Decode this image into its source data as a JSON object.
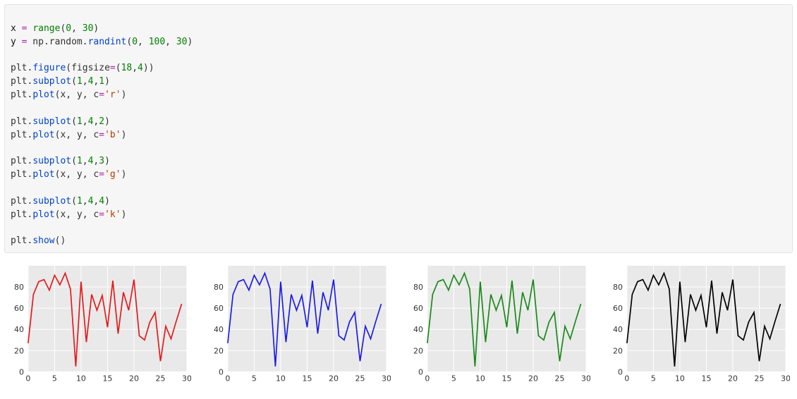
{
  "code": {
    "line1_a": "x ",
    "line1_op1": "=",
    "line1_b": " ",
    "line1_fn": "range",
    "line1_c": "(",
    "line1_n1": "0",
    "line1_d": ", ",
    "line1_n2": "30",
    "line1_e": ")",
    "line2_a": "y ",
    "line2_op1": "=",
    "line2_b": " np.random.",
    "line2_fn": "randint",
    "line2_c": "(",
    "line2_n1": "0",
    "line2_d": ", ",
    "line2_n2": "100",
    "line2_e": ", ",
    "line2_n3": "30",
    "line2_f": ")",
    "line3_a": "plt.",
    "line3_fn": "figure",
    "line3_b": "(figsize",
    "line3_op": "=",
    "line3_c": "(",
    "line3_n1": "18",
    "line3_d": ",",
    "line3_n2": "4",
    "line3_e": "))",
    "line4_a": "plt.",
    "line4_fn": "subplot",
    "line4_b": "(",
    "line4_n1": "1",
    "line4_c": ",",
    "line4_n2": "4",
    "line4_d": ",",
    "line4_n3": "1",
    "line4_e": ")",
    "line5_a": "plt.",
    "line5_fn": "plot",
    "line5_b": "(x, y, c",
    "line5_op": "=",
    "line5_s": "'r'",
    "line5_c": ")",
    "line6_a": "plt.",
    "line6_fn": "subplot",
    "line6_b": "(",
    "line6_n1": "1",
    "line6_c": ",",
    "line6_n2": "4",
    "line6_d": ",",
    "line6_n3": "2",
    "line6_e": ")",
    "line7_a": "plt.",
    "line7_fn": "plot",
    "line7_b": "(x, y, c",
    "line7_op": "=",
    "line7_s": "'b'",
    "line7_c": ")",
    "line8_a": "plt.",
    "line8_fn": "subplot",
    "line8_b": "(",
    "line8_n1": "1",
    "line8_c": ",",
    "line8_n2": "4",
    "line8_d": ",",
    "line8_n3": "3",
    "line8_e": ")",
    "line9_a": "plt.",
    "line9_fn": "plot",
    "line9_b": "(x, y, c",
    "line9_op": "=",
    "line9_s": "'g'",
    "line9_c": ")",
    "line10_a": "plt.",
    "line10_fn": "subplot",
    "line10_b": "(",
    "line10_n1": "1",
    "line10_c": ",",
    "line10_n2": "4",
    "line10_d": ",",
    "line10_n3": "4",
    "line10_e": ")",
    "line11_a": "plt.",
    "line11_fn": "plot",
    "line11_b": "(x, y, c",
    "line11_op": "=",
    "line11_s": "'k'",
    "line11_c": ")",
    "line12_a": "plt.",
    "line12_fn": "show",
    "line12_b": "()"
  },
  "chart_data": [
    {
      "type": "line",
      "x": [
        0,
        1,
        2,
        3,
        4,
        5,
        6,
        7,
        8,
        9,
        10,
        11,
        12,
        13,
        14,
        15,
        16,
        17,
        18,
        19,
        20,
        21,
        22,
        23,
        24,
        25,
        26,
        27,
        28,
        29
      ],
      "values": [
        27,
        73,
        85,
        87,
        77,
        91,
        82,
        93,
        78,
        5,
        85,
        28,
        73,
        58,
        72,
        42,
        86,
        36,
        75,
        58,
        87,
        34,
        30,
        47,
        56,
        10,
        43,
        31,
        48,
        64
      ],
      "color": "#e41a1c",
      "xlim": [
        0,
        30
      ],
      "ylim": [
        0,
        100
      ],
      "xticks": [
        0,
        5,
        10,
        15,
        20,
        25,
        30
      ],
      "yticks": [
        0,
        20,
        40,
        60,
        80
      ]
    },
    {
      "type": "line",
      "x": [
        0,
        1,
        2,
        3,
        4,
        5,
        6,
        7,
        8,
        9,
        10,
        11,
        12,
        13,
        14,
        15,
        16,
        17,
        18,
        19,
        20,
        21,
        22,
        23,
        24,
        25,
        26,
        27,
        28,
        29
      ],
      "values": [
        27,
        73,
        85,
        87,
        77,
        91,
        82,
        93,
        78,
        5,
        85,
        28,
        73,
        58,
        72,
        42,
        86,
        36,
        75,
        58,
        87,
        34,
        30,
        47,
        56,
        10,
        43,
        31,
        48,
        64
      ],
      "color": "#1c1ce8",
      "xlim": [
        0,
        30
      ],
      "ylim": [
        0,
        100
      ],
      "xticks": [
        0,
        5,
        10,
        15,
        20,
        25,
        30
      ],
      "yticks": [
        0,
        20,
        40,
        60,
        80
      ]
    },
    {
      "type": "line",
      "x": [
        0,
        1,
        2,
        3,
        4,
        5,
        6,
        7,
        8,
        9,
        10,
        11,
        12,
        13,
        14,
        15,
        16,
        17,
        18,
        19,
        20,
        21,
        22,
        23,
        24,
        25,
        26,
        27,
        28,
        29
      ],
      "values": [
        27,
        73,
        85,
        87,
        77,
        91,
        82,
        93,
        78,
        5,
        85,
        28,
        73,
        58,
        72,
        42,
        86,
        36,
        75,
        58,
        87,
        34,
        30,
        47,
        56,
        10,
        43,
        31,
        48,
        64
      ],
      "color": "#188a18",
      "xlim": [
        0,
        30
      ],
      "ylim": [
        0,
        100
      ],
      "xticks": [
        0,
        5,
        10,
        15,
        20,
        25,
        30
      ],
      "yticks": [
        0,
        20,
        40,
        60,
        80
      ]
    },
    {
      "type": "line",
      "x": [
        0,
        1,
        2,
        3,
        4,
        5,
        6,
        7,
        8,
        9,
        10,
        11,
        12,
        13,
        14,
        15,
        16,
        17,
        18,
        19,
        20,
        21,
        22,
        23,
        24,
        25,
        26,
        27,
        28,
        29
      ],
      "values": [
        27,
        73,
        85,
        87,
        77,
        91,
        82,
        93,
        78,
        5,
        85,
        28,
        73,
        58,
        72,
        42,
        86,
        36,
        75,
        58,
        87,
        34,
        30,
        47,
        56,
        10,
        43,
        31,
        48,
        64
      ],
      "color": "#000000",
      "xlim": [
        0,
        30
      ],
      "ylim": [
        0,
        100
      ],
      "xticks": [
        0,
        5,
        10,
        15,
        20,
        25,
        30
      ],
      "yticks": [
        0,
        20,
        40,
        60,
        80
      ]
    }
  ]
}
